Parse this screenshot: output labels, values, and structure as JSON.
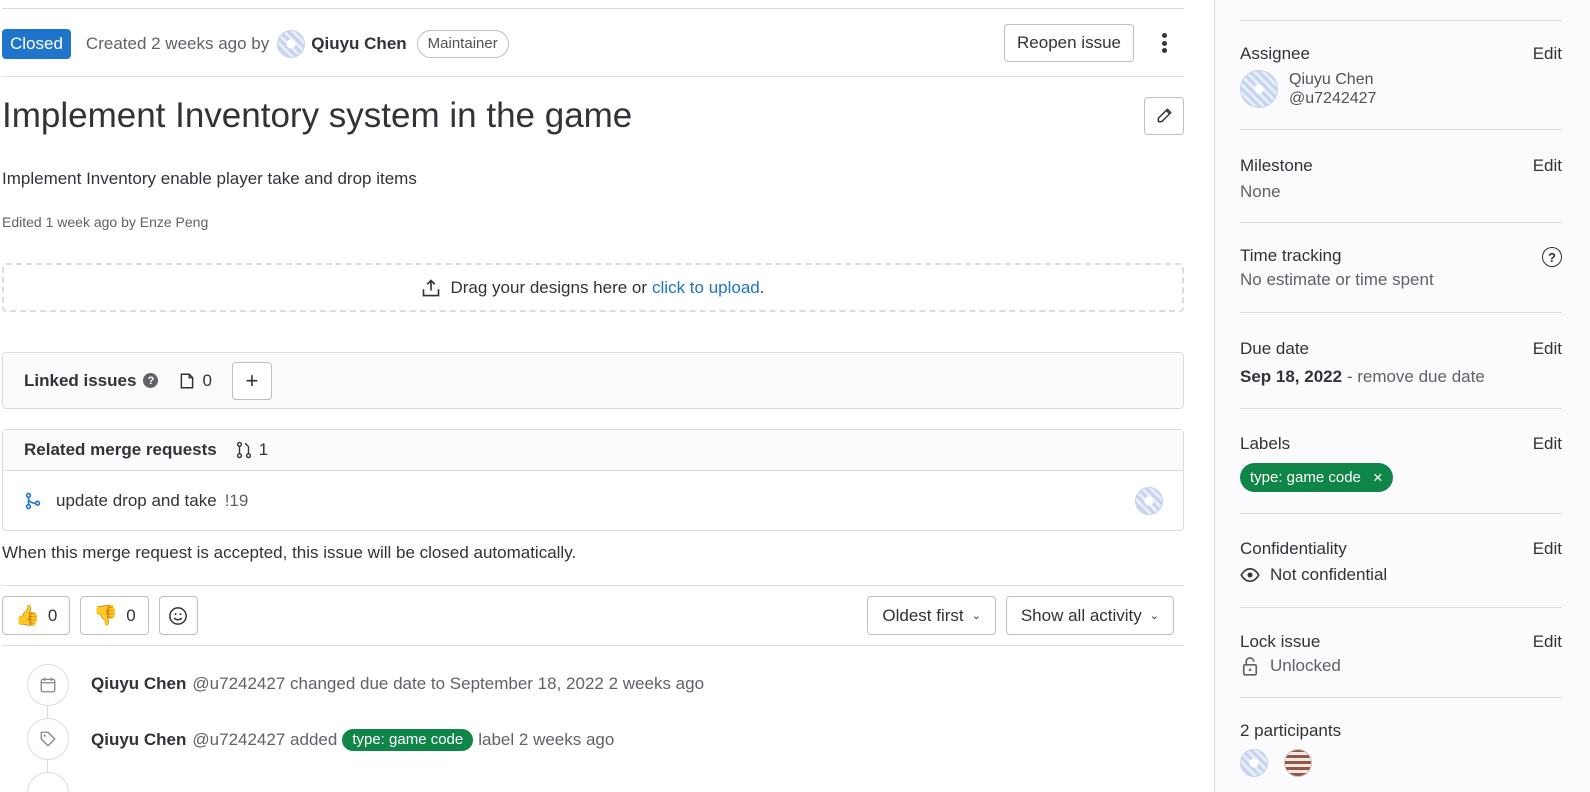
{
  "issue": {
    "status": "Closed",
    "created_text": "Created 2 weeks ago by",
    "author": "Qiuyu Chen",
    "author_role": "Maintainer",
    "reopen_label": "Reopen issue",
    "title": "Implement Inventory system in the game",
    "description": "Implement Inventory enable player take and drop items",
    "edited_text": "Edited 1 week ago by Enze Peng"
  },
  "design_upload": {
    "text": "Drag your designs here or",
    "link": "click to upload",
    "suffix": "."
  },
  "linked_issues": {
    "title": "Linked issues",
    "help": "?",
    "count": "0",
    "add": "+"
  },
  "related_mrs": {
    "title": "Related merge requests",
    "count": "1",
    "items": [
      {
        "title": "update drop and take",
        "ref": "!19"
      }
    ],
    "note": "When this merge request is accepted, this issue will be closed automatically."
  },
  "awards": {
    "thumbs_up": "0",
    "thumbs_down": "0"
  },
  "sorting": {
    "order": "Oldest first",
    "filter": "Show all activity"
  },
  "activity": [
    {
      "who": "Qiuyu Chen",
      "handle": "@u7242427",
      "action": "changed due date to September 18, 2022",
      "when": "2 weeks ago"
    },
    {
      "who": "Qiuyu Chen",
      "handle": "@u7242427",
      "action": "added",
      "label": "type: game code",
      "action_after": "label",
      "when": "2 weeks ago"
    }
  ],
  "sidebar": {
    "edit": "Edit",
    "assignee": {
      "title": "Assignee",
      "name": "Qiuyu Chen",
      "handle": "@u7242427"
    },
    "milestone": {
      "title": "Milestone",
      "value": "None"
    },
    "time_tracking": {
      "title": "Time tracking",
      "value": "No estimate or time spent",
      "help": "?"
    },
    "due_date": {
      "title": "Due date",
      "value": "Sep 18, 2022",
      "remove": "- remove due date"
    },
    "labels": {
      "title": "Labels",
      "items": [
        "type: game code"
      ],
      "remove": "×"
    },
    "confidentiality": {
      "title": "Confidentiality",
      "value": "Not confidential"
    },
    "lock": {
      "title": "Lock issue",
      "value": "Unlocked"
    },
    "participants": {
      "title": "2 participants"
    }
  },
  "colors": {
    "accent": "#1f75cb",
    "label_green": "#108548",
    "thumbs": "#f5b820"
  }
}
